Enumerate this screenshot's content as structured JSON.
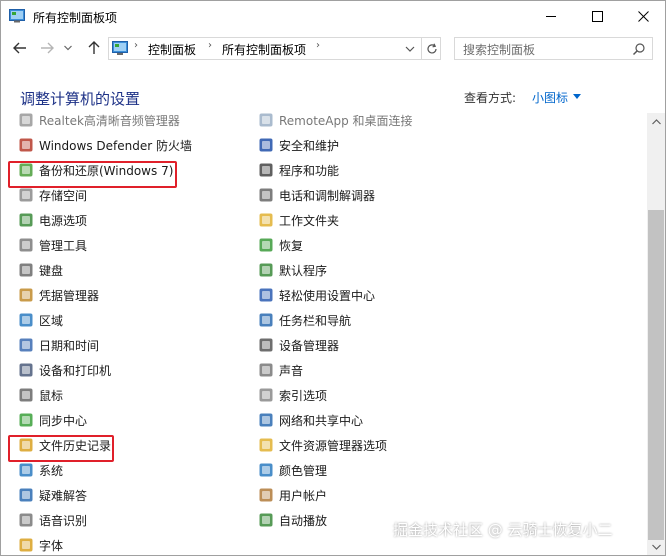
{
  "window": {
    "title": "所有控制面板项",
    "icon": "control-panel-icon"
  },
  "nav": {
    "breadcrumb": [
      "控制面板",
      "所有控制面板项"
    ],
    "search_placeholder": "搜索控制面板"
  },
  "header": {
    "title": "调整计算机的设置",
    "view_by_label": "查看方式:",
    "view_by_value": "小图标"
  },
  "items_left": [
    {
      "label": "Realtek高清晰音频管理器",
      "icon": "speaker-icon",
      "partial": true
    },
    {
      "label": "Windows Defender 防火墙",
      "icon": "firewall-icon"
    },
    {
      "label": "备份和还原(Windows 7)",
      "icon": "backup-icon",
      "highlighted": true
    },
    {
      "label": "存储空间",
      "icon": "storage-icon"
    },
    {
      "label": "电源选项",
      "icon": "power-icon"
    },
    {
      "label": "管理工具",
      "icon": "admin-tools-icon"
    },
    {
      "label": "键盘",
      "icon": "keyboard-icon"
    },
    {
      "label": "凭据管理器",
      "icon": "credential-icon"
    },
    {
      "label": "区域",
      "icon": "region-icon"
    },
    {
      "label": "日期和时间",
      "icon": "datetime-icon"
    },
    {
      "label": "设备和打印机",
      "icon": "printer-icon"
    },
    {
      "label": "鼠标",
      "icon": "mouse-icon"
    },
    {
      "label": "同步中心",
      "icon": "sync-icon"
    },
    {
      "label": "文件历史记录",
      "icon": "file-history-icon",
      "highlighted": true
    },
    {
      "label": "系统",
      "icon": "system-icon"
    },
    {
      "label": "疑难解答",
      "icon": "troubleshoot-icon"
    },
    {
      "label": "语音识别",
      "icon": "microphone-icon"
    },
    {
      "label": "字体",
      "icon": "font-icon"
    }
  ],
  "items_right": [
    {
      "label": "RemoteApp 和桌面连接",
      "icon": "remoteapp-icon",
      "partial": true
    },
    {
      "label": "安全和维护",
      "icon": "flag-icon"
    },
    {
      "label": "程序和功能",
      "icon": "programs-icon"
    },
    {
      "label": "电话和调制解调器",
      "icon": "phone-icon"
    },
    {
      "label": "工作文件夹",
      "icon": "work-folders-icon"
    },
    {
      "label": "恢复",
      "icon": "recovery-icon"
    },
    {
      "label": "默认程序",
      "icon": "default-programs-icon"
    },
    {
      "label": "轻松使用设置中心",
      "icon": "ease-of-access-icon"
    },
    {
      "label": "任务栏和导航",
      "icon": "taskbar-icon"
    },
    {
      "label": "设备管理器",
      "icon": "device-manager-icon"
    },
    {
      "label": "声音",
      "icon": "sound-icon"
    },
    {
      "label": "索引选项",
      "icon": "indexing-icon"
    },
    {
      "label": "网络和共享中心",
      "icon": "network-icon"
    },
    {
      "label": "文件资源管理器选项",
      "icon": "folder-options-icon"
    },
    {
      "label": "颜色管理",
      "icon": "color-management-icon"
    },
    {
      "label": "用户帐户",
      "icon": "user-accounts-icon"
    },
    {
      "label": "自动播放",
      "icon": "autoplay-icon"
    }
  ],
  "watermark": "掘金技术社区 @ 云骑士恢复小二",
  "colors": {
    "heading": "#1e3287",
    "link": "#0066cc",
    "highlight": "#e0202a"
  }
}
